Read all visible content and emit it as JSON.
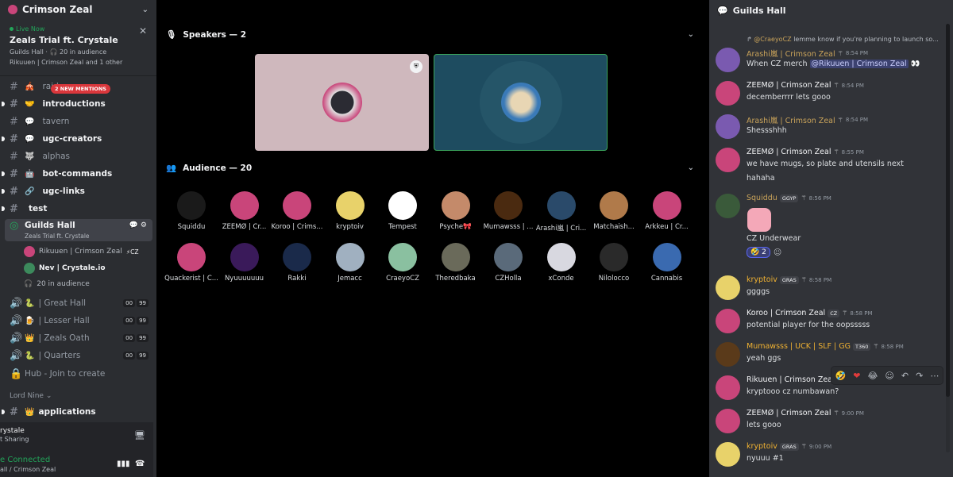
{
  "server": {
    "name": "Crimson Zeal"
  },
  "live": {
    "tag": "Live Now",
    "title": "Zeals Trial ft. Crystale",
    "sub1": "Guilds Hall · 🎧 20 in audience",
    "sub2": "Rikuuen | Crimson Zeal and 1 other"
  },
  "mentions_pill": "2 NEW MENTIONS",
  "channels": [
    {
      "name": "raid",
      "emoji": "🎪",
      "unread": false
    },
    {
      "name": "introductions",
      "emoji": "🤝",
      "unread": true
    },
    {
      "name": "tavern",
      "emoji": "💬",
      "unread": false
    },
    {
      "name": "ugc-creators",
      "emoji": "💬",
      "unread": true
    },
    {
      "name": "alphas",
      "emoji": "🐺",
      "unread": false
    },
    {
      "name": "bot-commands",
      "emoji": "🤖",
      "unread": true
    },
    {
      "name": "ugc-links",
      "emoji": "🔗",
      "unread": true
    },
    {
      "name": "test",
      "emoji": "",
      "unread": true
    }
  ],
  "stage_channel": {
    "name": "Guilds Hall",
    "sub": "Zeals Trial ft. Crystale"
  },
  "stage_users": [
    {
      "name": "Rikuuen | Crimson Zeal",
      "tag": "⚡CZ"
    },
    {
      "name": "Nev | Crystale.io",
      "tag": ""
    },
    {
      "name": "20 in audience",
      "tag": ""
    }
  ],
  "voice_channels": [
    {
      "name": "| Great Hall",
      "emoji": "🐍",
      "a": "00",
      "b": "99"
    },
    {
      "name": "| Lesser Hall",
      "emoji": "🍺",
      "a": "00",
      "b": "99"
    },
    {
      "name": "| Zeals Oath",
      "emoji": "👑",
      "a": "00",
      "b": "99"
    },
    {
      "name": "| Quarters",
      "emoji": "🐍",
      "a": "00",
      "b": "99"
    }
  ],
  "hub": "Hub - Join to create",
  "category": "Lord Nine",
  "applications": {
    "name": "applications",
    "emoji": "👑"
  },
  "user_panel": {
    "l1": "rystale",
    "l2": "t Sharing",
    "conn": "e Connected",
    "conn2": "all / Crimson Zeal"
  },
  "speakers_label": "Speakers — 2",
  "audience_label": "Audience — 20",
  "audience_row1": [
    "Squiddu",
    "ZEEMØ | Cr...",
    "Koroo | Crims...",
    "kryptoiv",
    "Tempest",
    "Psyche🎀",
    "Mumawsss | ...",
    "Arashi嵐 | Cri...",
    "Matchaish...",
    "Arkkeu | Cr..."
  ],
  "audience_row2": [
    "Quackerist | C...",
    "Nyuuuuuuu",
    "Rakki",
    "Jemacc",
    "CraeyoCZ",
    "Theredbaka",
    "CZHolla",
    "xConde",
    "Nilolocco",
    "Cannabis"
  ],
  "chat": {
    "title": "Guilds Hall",
    "reply_who": "@CraeyoCZ",
    "reply_text": "lemme know if you're planning to launch so...",
    "messages": [
      {
        "name": "Arashi嵐 | Crimson Zeal",
        "time": "8:54 PM",
        "text": "When CZ merch",
        "mention": "@Rikuuen | Crimson Zeal",
        "tail": "👀",
        "color": "#c9a35a"
      },
      {
        "name": "ZEEMØ | Crimson Zeal",
        "time": "8:54 PM",
        "text": "decemberrrr lets gooo"
      },
      {
        "name": "Arashi嵐 | Crimson Zeal",
        "time": "8:54 PM",
        "text": "Shessshhh",
        "color": "#c9a35a"
      },
      {
        "name": "ZEEMØ | Crimson Zeal",
        "time": "8:55 PM",
        "text": "we have mugs, so plate and utensils next",
        "text2": "hahaha"
      },
      {
        "name": "Squiddu",
        "time": "8:56 PM",
        "tag": "GGYP",
        "text": "CZ Underwear",
        "color": "#c9a35a"
      },
      {
        "name": "kryptoiv",
        "time": "8:58 PM",
        "tag": "GRAS",
        "text": "ggggs",
        "color": "#f0b232"
      },
      {
        "name": "Koroo | Crimson Zeal",
        "time": "8:58 PM",
        "tag": "CZ",
        "text": "potential player for the oopsssss"
      },
      {
        "name": "Mumawsss | UCK | SLF | GG",
        "time": "8:58 PM",
        "tag": "T360",
        "text": "yeah ggs",
        "color": "#f0b232"
      },
      {
        "name": "Rikuuen | Crimson Zeal",
        "time": "",
        "text": "kryptooo cz numbawan?"
      },
      {
        "name": "ZEEMØ | Crimson Zeal",
        "time": "9:00 PM",
        "text": "lets gooo"
      },
      {
        "name": "kryptoiv",
        "time": "9:00 PM",
        "tag": "GRAS",
        "text": "nyuuu #1",
        "color": "#f0b232"
      }
    ],
    "reaction": {
      "emoji": "🤣",
      "count": "2"
    }
  }
}
